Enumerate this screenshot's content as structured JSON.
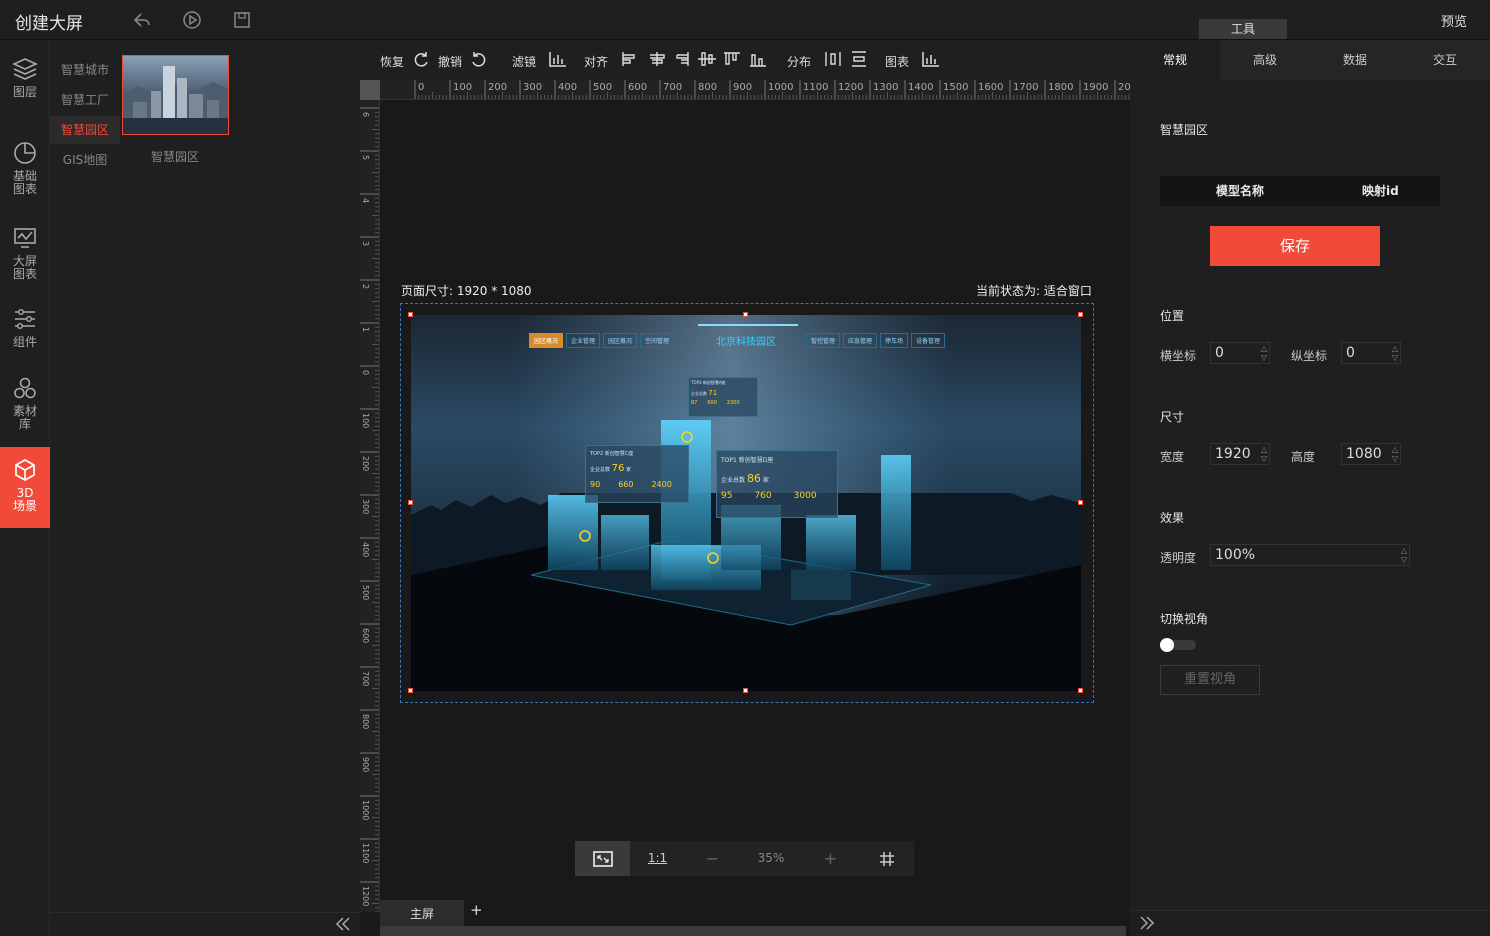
{
  "header": {
    "title": "创建大屏",
    "tool_tab": "工具",
    "preview": "预览"
  },
  "leftnav": {
    "items": [
      {
        "label1": "图层",
        "label2": "",
        "icon": "layers-icon"
      },
      {
        "label1": "基础",
        "label2": "图表",
        "icon": "pie-chart-icon"
      },
      {
        "label1": "大屏",
        "label2": "图表",
        "icon": "monitor-chart-icon"
      },
      {
        "label1": "组件",
        "label2": "",
        "icon": "sliders-icon"
      },
      {
        "label1": "素材",
        "label2": "库",
        "icon": "materials-icon"
      },
      {
        "label1": "3D",
        "label2": "场景",
        "icon": "cube-icon"
      }
    ],
    "active_index": 5
  },
  "catalog": {
    "categories": [
      "智慧城市",
      "智慧工厂",
      "智慧园区",
      "GIS地图"
    ],
    "active": "智慧园区",
    "thumbnail_label": "智慧园区"
  },
  "canvas_toolbar": {
    "redo": "恢复",
    "undo": "撤销",
    "filter": "滤镜",
    "align": "对齐",
    "distribute": "分布",
    "chart": "图表"
  },
  "ruler": {
    "top_ticks": [
      "0",
      "100",
      "200",
      "300",
      "400",
      "500",
      "600",
      "700",
      "800",
      "900",
      "1000",
      "1100",
      "1200",
      "1300",
      "1400",
      "1500",
      "1600",
      "1700",
      "1800",
      "1900",
      "200"
    ],
    "left_ticks": [
      "6",
      "5",
      "4",
      "3",
      "2",
      "1",
      "0",
      "100",
      "200",
      "300",
      "400",
      "500",
      "600",
      "700",
      "800",
      "900",
      "1000",
      "1100",
      "1200"
    ]
  },
  "canvas": {
    "page_size": "页面尺寸: 1920 * 1080",
    "current_state": "当前状态为: 适合窗口"
  },
  "scene": {
    "title": "北京科技园区",
    "nav_left": [
      "园区概况",
      "企业管理",
      "园区概况",
      "空间管理"
    ],
    "nav_right": [
      "智控管理",
      "应急管理",
      "停车场",
      "设备管理"
    ],
    "cards": [
      {
        "title": "TOP1 新创智慧D座",
        "main_label": "企业总数",
        "main_value": "86",
        "unit": "家",
        "stats": [
          "95",
          "760",
          "3000"
        ],
        "stat_labels": [
          "入驻率",
          "总人数",
          "总面积"
        ]
      },
      {
        "title": "TOP2 新创智慧C座",
        "main_label": "企业总数",
        "main_value": "76",
        "unit": "家",
        "stats": [
          "90",
          "660",
          "2400"
        ],
        "stat_labels": [
          "入驻率",
          "总人数",
          "总面积"
        ]
      },
      {
        "title": "TOP3 新创智慧A座",
        "main_label": "企业总数",
        "main_value": "71",
        "unit": "家",
        "stats": [
          "87",
          "600",
          "2300"
        ],
        "stat_labels": [
          "入驻率",
          "总人数",
          "总面积"
        ]
      }
    ]
  },
  "zoom": {
    "one_to_one": "1:1",
    "minus": "−",
    "value": "35%",
    "plus": "+"
  },
  "screens": {
    "tab": "主屏",
    "add": "+"
  },
  "props": {
    "tabs": [
      "常规",
      "高级",
      "数据",
      "交互"
    ],
    "active_tab": "常规",
    "name": "智慧园区",
    "table_headers": [
      "模型名称",
      "映射id"
    ],
    "save": "保存",
    "position_title": "位置",
    "x_label": "横坐标",
    "x_value": "0",
    "y_label": "纵坐标",
    "y_value": "0",
    "size_title": "尺寸",
    "w_label": "宽度",
    "w_value": "1920",
    "h_label": "高度",
    "h_value": "1080",
    "effect_title": "效果",
    "opacity_label": "透明度",
    "opacity_value": "100%",
    "view_title": "切换视角",
    "view_toggle_on": false,
    "reset_view": "重置视角"
  },
  "colors": {
    "accent": "#f24a38",
    "panel": "#1f1f1f",
    "highlight_text": "#ffd21f",
    "scene_cyan": "#3ad0ff"
  }
}
